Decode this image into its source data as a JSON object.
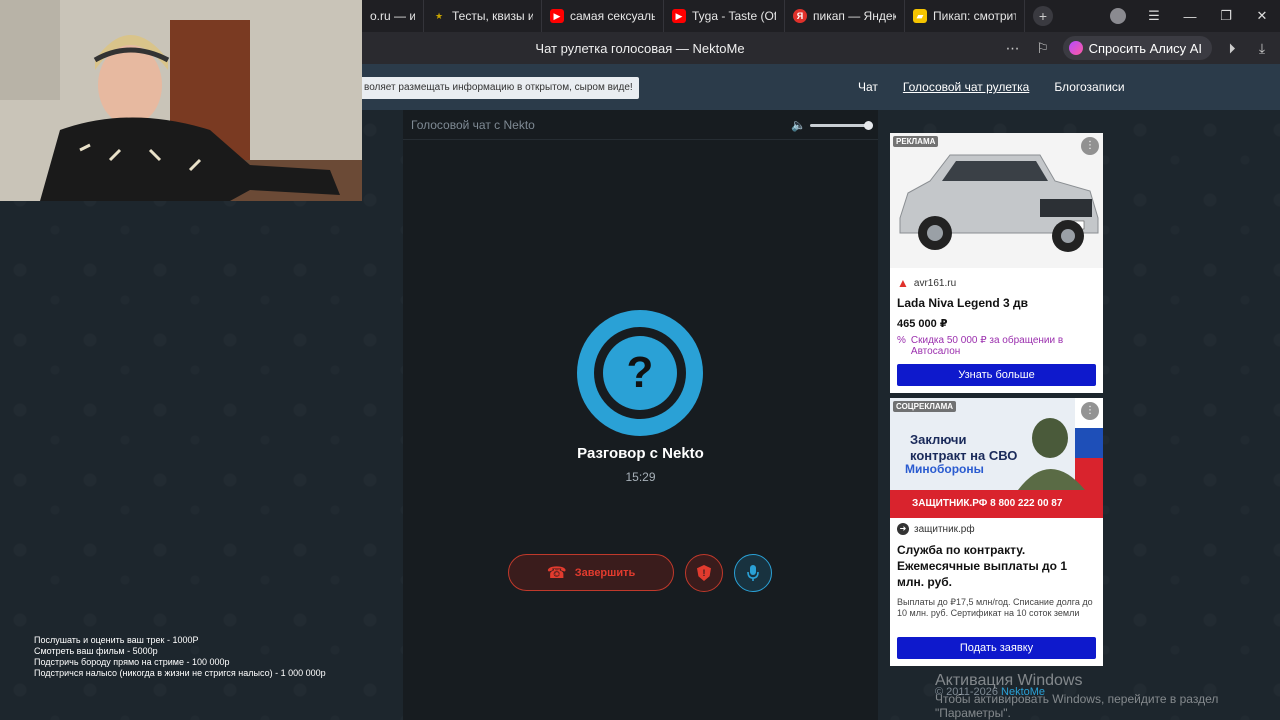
{
  "browser": {
    "tabs": [
      {
        "label": "o.ru — инте",
        "icon": "site-icon",
        "color": "#2aa1d6"
      },
      {
        "label": "Тесты, квизы и т",
        "icon": "star-icon",
        "color": "#c8a400"
      },
      {
        "label": "самая сексуаль",
        "icon": "youtube-icon",
        "color": "#ff0000"
      },
      {
        "label": "Tyga - Taste (Off",
        "icon": "youtube-icon",
        "color": "#ff0000"
      },
      {
        "label": "пикап — Яндекс",
        "icon": "yandex-icon",
        "color": "#e0312b"
      },
      {
        "label": "Пикап: смотрите",
        "icon": "bookmark-icon",
        "color": "#f5c400"
      }
    ],
    "page_title": "Чат рулетка голосовая — NektoMe",
    "alice_label": "Спросить Алису AI"
  },
  "site": {
    "notice": "воляет размещать информацию в открытом, сыром виде!",
    "nav": [
      "Чат",
      "Голосовой чат рулетка",
      "Блогозаписи"
    ],
    "nav_active_index": 1
  },
  "chat": {
    "header": "Голосовой чат с Nekto",
    "conversation_title": "Разговор с Nekto",
    "timer": "15:29",
    "end_button": "Завершить",
    "accent_color": "#2aa1d6",
    "danger_color": "#e23b2e",
    "volume_level": 1.0
  },
  "ads": {
    "ad1": {
      "label": "РЕКЛАМА",
      "domain": "avr161.ru",
      "title": "Lada Niva Legend 3 дв",
      "price": "465 000 ₽",
      "promo": "Скидка 50 000 ₽ за обращении в Автосалон",
      "button": "Узнать больше"
    },
    "ad2": {
      "label": "СОЦРЕКЛАМА",
      "banner_line1": "Заключи",
      "banner_line2": "контракт на СВО",
      "banner_line3": "Минобороны",
      "banner_stripe": "ЗАЩИТНИК.РФ  8 800 222 00 87",
      "domain": "защитник.рф",
      "title": "Служба по контракту. Ежемесячные выплаты до 1 млн. руб.",
      "subtitle": "Выплаты до ₽17,5 млн/год. Списание долга до 10 млн. руб. Сертификат на 10 соток земли",
      "button": "Подать заявку"
    }
  },
  "overlay_text": [
    "Послушать и оценить ваш трек - 1000Р",
    "Смотреть ваш фильм - 5000р",
    "Подстричь бороду прямо на стриме - 100 000р",
    "Подстричся налысо (никогда в жизни не стригся налысо) - 1 000 000р"
  ],
  "footer": {
    "copyright": "© 2011-2026",
    "brand": "NektoMe"
  },
  "windows_activation": {
    "title": "Активация Windows",
    "line1": "Чтобы активировать Windows, перейдите в раздел",
    "line2": "\"Параметры\"."
  }
}
